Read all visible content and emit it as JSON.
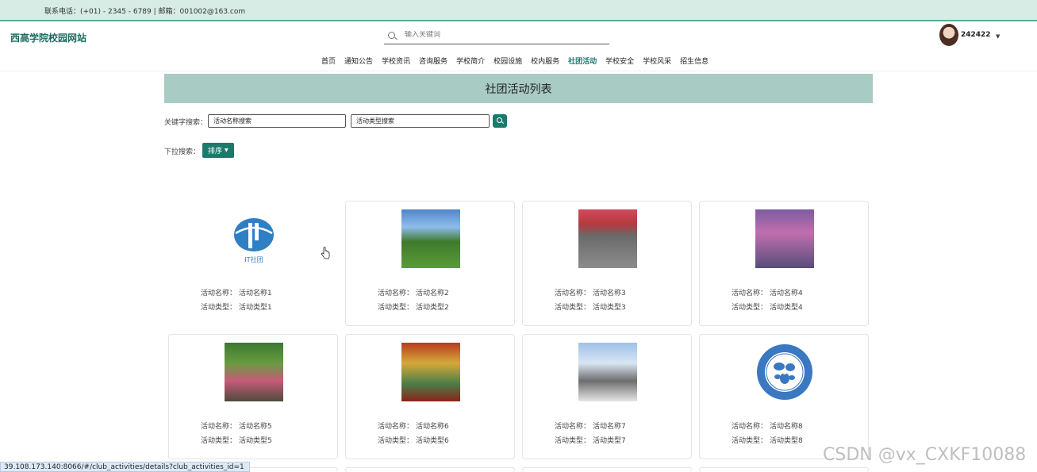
{
  "topbar": {
    "contact": "联系电话：(+01) - 2345 - 6789 | 邮箱：001002@163.com"
  },
  "header": {
    "site_title": "西高学院校园网站",
    "search_placeholder": "输入关键词",
    "username": "242422"
  },
  "nav": {
    "items": [
      {
        "label": "首页"
      },
      {
        "label": "通知公告"
      },
      {
        "label": "学校资讯"
      },
      {
        "label": "咨询服务"
      },
      {
        "label": "学校简介"
      },
      {
        "label": "校园设施"
      },
      {
        "label": "校内服务"
      },
      {
        "label": "社团活动"
      },
      {
        "label": "学校安全"
      },
      {
        "label": "学校风采"
      },
      {
        "label": "招生信息"
      }
    ],
    "active": "社团活动"
  },
  "banner": {
    "title": "社团活动列表"
  },
  "filters": {
    "keyword_label": "关键字搜索：",
    "name_placeholder": "活动名称搜索",
    "type_placeholder": "活动类型搜索",
    "dropdown_label": "下拉搜索：",
    "sort_label": "排序"
  },
  "cards": [
    {
      "name_label": "活动名称：",
      "name": "活动名称1",
      "type_label": "活动类型：",
      "type": "活动类型1",
      "image_text": "IT社团"
    },
    {
      "name_label": "活动名称：",
      "name": "活动名称2",
      "type_label": "活动类型：",
      "type": "活动类型2"
    },
    {
      "name_label": "活动名称：",
      "name": "活动名称3",
      "type_label": "活动类型：",
      "type": "活动类型3"
    },
    {
      "name_label": "活动名称：",
      "name": "活动名称4",
      "type_label": "活动类型：",
      "type": "活动类型4"
    },
    {
      "name_label": "活动名称：",
      "name": "活动名称5",
      "type_label": "活动类型：",
      "type": "活动类型5"
    },
    {
      "name_label": "活动名称：",
      "name": "活动名称6",
      "type_label": "活动类型：",
      "type": "活动类型6"
    },
    {
      "name_label": "活动名称：",
      "name": "活动名称7",
      "type_label": "活动类型：",
      "type": "活动类型7"
    },
    {
      "name_label": "活动名称：",
      "name": "活动名称8",
      "type_label": "活动类型：",
      "type": "活动类型8"
    }
  ],
  "status_bar": {
    "url": "39.108.173.140:8066/#/club_activities/details?club_activities_id=1"
  },
  "watermark": "CSDN @vx_CXKF10088",
  "colors": {
    "accent": "#1c7a6c",
    "topbar_bg": "#d6ece5",
    "banner_bg": "#a8cbc4"
  }
}
